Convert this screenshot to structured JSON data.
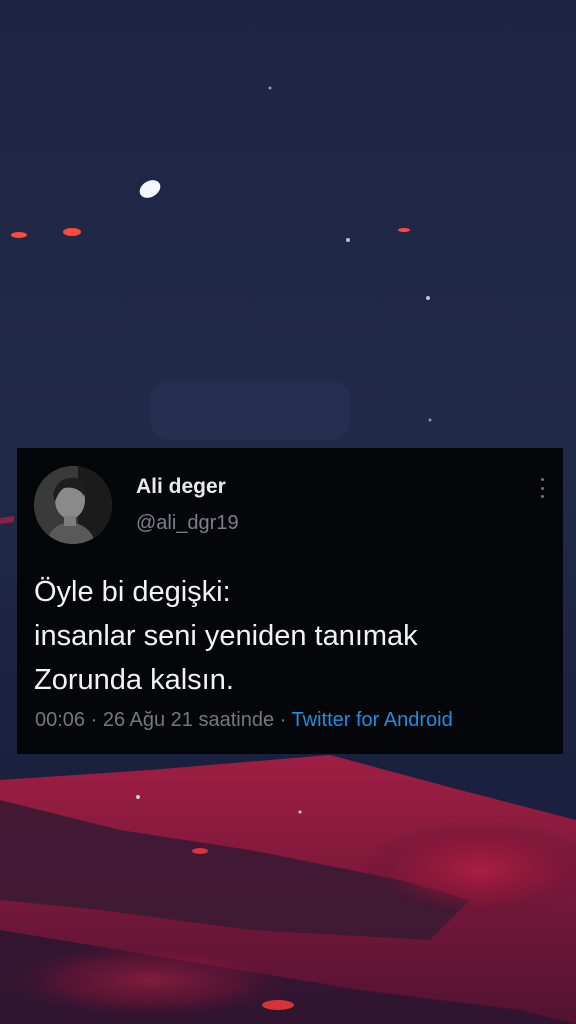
{
  "tweet": {
    "display_name": "Ali deger",
    "handle": "@ali_dgr19",
    "text_lines": [
      "Öyle bi degişki:",
      "insanlar seni yeniden tanımak",
      "Zorunda kalsın."
    ],
    "timestamp": "00:06 · 26 Ağu 21 saatinde",
    "separator": " · ",
    "source": "Twitter for Android"
  },
  "icons": {
    "more": "vertical-ellipsis-icon",
    "avatar": "user-photo"
  },
  "colors": {
    "card_background": "#05060a",
    "link_blue": "#1d8fe0",
    "muted_gray": "#73787f",
    "night_sky": "#1f2745",
    "red_glow": "#d8274a"
  }
}
